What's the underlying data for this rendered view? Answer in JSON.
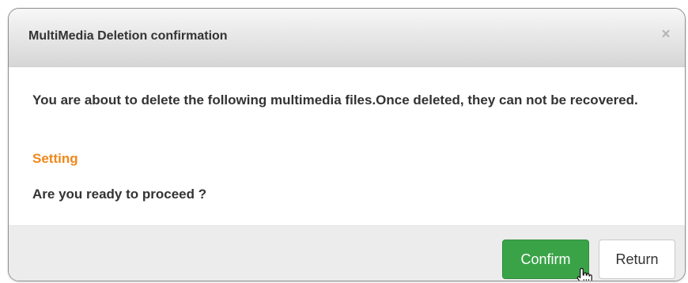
{
  "dialog": {
    "title": "MultiMedia Deletion confirmation",
    "close_icon": "close-icon",
    "message": "You are about to delete the following multimedia files.Once deleted, they can not be recovered.",
    "item": "Setting",
    "question": "Are you ready to proceed ?",
    "confirm_label": "Confirm",
    "return_label": "Return"
  },
  "colors": {
    "item_highlight": "#f0871a",
    "confirm_button": "#3aa348",
    "text": "#333333"
  },
  "cursor": {
    "icon": "hand-pointer-icon"
  }
}
